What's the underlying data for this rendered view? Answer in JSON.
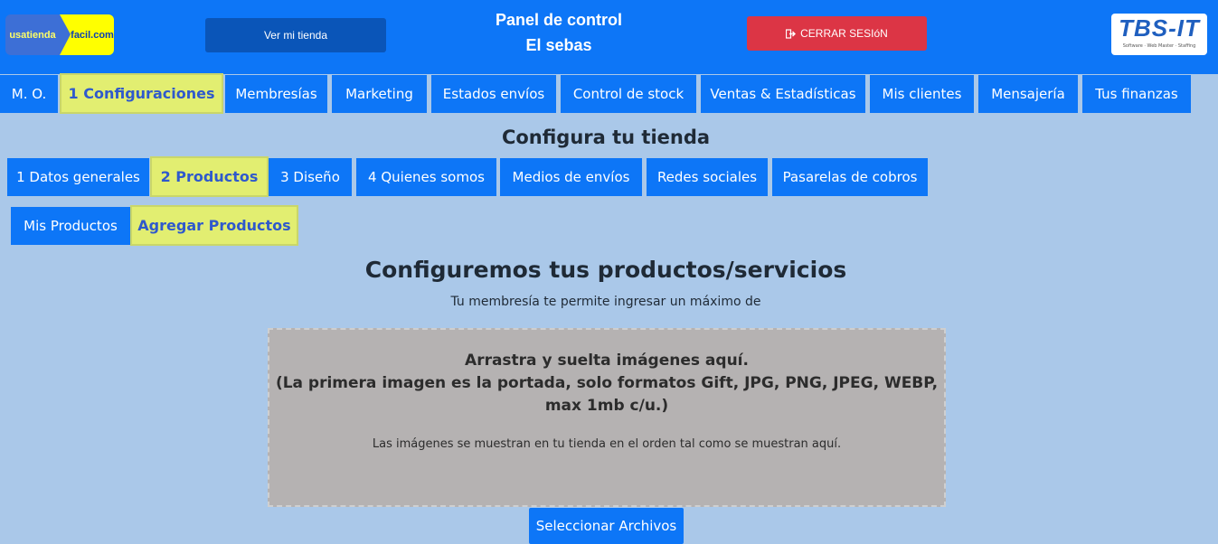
{
  "header": {
    "logo_left_a": "usatienda",
    "logo_left_b": "facil.com",
    "ver_tienda": "Ver mi tienda",
    "title_line1": "Panel de control",
    "title_line2": "El sebas",
    "cerrar_icon": "logout-icon",
    "cerrar_label": "CERRAR SESIóN",
    "logo_right": "TBS-IT",
    "logo_right_tagline": "Software · Web Master · Staffing"
  },
  "main_tabs": [
    {
      "label": "M. O."
    },
    {
      "label": "1 Configuraciones",
      "active": true
    },
    {
      "label": "Membresías"
    },
    {
      "label": "Marketing"
    },
    {
      "label": "Estados envíos"
    },
    {
      "label": "Control de stock"
    },
    {
      "label": "Ventas & Estadísticas"
    },
    {
      "label": "Mis clientes"
    },
    {
      "label": "Mensajería"
    },
    {
      "label": "Tus finanzas"
    }
  ],
  "config_title": "Configura tu tienda",
  "config_tabs": [
    {
      "label": "1 Datos generales"
    },
    {
      "label": "2 Productos",
      "active": true
    },
    {
      "label": "3 Diseño"
    },
    {
      "label": "4 Quienes somos"
    },
    {
      "label": "Medios de envíos"
    },
    {
      "label": "Redes sociales"
    },
    {
      "label": "Pasarelas de cobros"
    }
  ],
  "product_tabs": [
    {
      "label": "Mis Productos"
    },
    {
      "label": "Agregar Productos",
      "active": true
    }
  ],
  "section": {
    "heading": "Configuremos tus productos/servicios",
    "subtitle": "Tu membresía te permite ingresar un máximo de"
  },
  "dropzone": {
    "line1": "Arrastra y suelta imágenes aquí.",
    "line2": "(La primera imagen es la portada, solo formatos Gift, JPG, PNG, JPEG, WEBP,",
    "line3": "max 1mb c/u.)",
    "note": "Las imágenes se muestran en tu tienda en el orden tal como se muestran aquí."
  },
  "select_files": "Seleccionar Archivos",
  "colors": {
    "primary": "#0d76f7",
    "active_tab": "#e2ee71",
    "background": "#aac8e9",
    "danger": "#dc3545",
    "dropzone": "#b5b2b2"
  }
}
